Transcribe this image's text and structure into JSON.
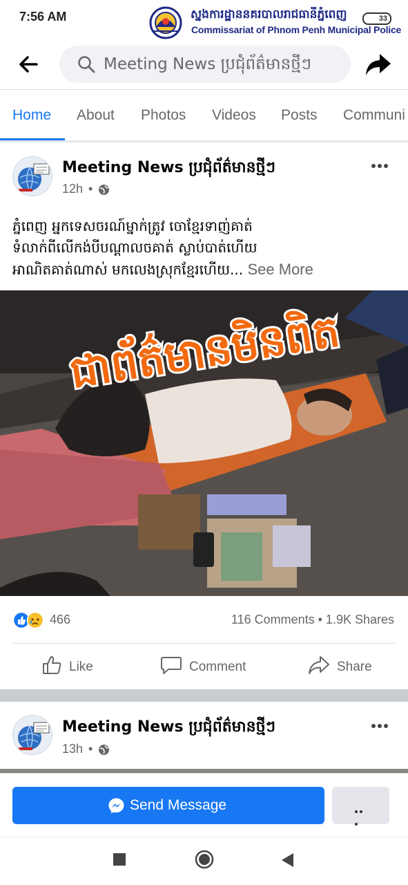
{
  "status_bar": {
    "time": "7:56 AM",
    "battery": "33"
  },
  "watermark": {
    "khmer_text": "ស្នងការដ្ឋាននគរបាលរាជធានីភ្នំពេញ",
    "english_text": "Commissariat of Phnom Penh Municipal Police"
  },
  "header": {
    "search_text": "Meeting News ប្រជុំព័ត៌មានថ្មីៗ"
  },
  "tabs": [
    {
      "label": "Home",
      "active": true
    },
    {
      "label": "About",
      "active": false
    },
    {
      "label": "Photos",
      "active": false
    },
    {
      "label": "Videos",
      "active": false
    },
    {
      "label": "Posts",
      "active": false
    },
    {
      "label": "Communi",
      "active": false
    }
  ],
  "post1": {
    "page_name": "Meeting News ប្រជុំព័ត៌មានថ្មីៗ",
    "time": "12h",
    "text_lines": [
      "ភ្នំពេញ អ្នកទេសចរណ៍ម្នាក់ត្រូវ ចោខ្មែរទាញ់គាត់",
      "ទំលាក់ពីលើកង់បីបណ្ដាលចគាត់ ស្លាប់បាត់ហើយ",
      "អាណិតគាត់ណាស់ មកលេងស្រុកខ្មែរហើយ..."
    ],
    "see_more": "See More",
    "image_overlay_text": "ជាព័ត៌មានមិនពិត",
    "reaction_count": "466",
    "comments_shares": "116 Comments • 1.9K Shares",
    "actions": {
      "like": "Like",
      "comment": "Comment",
      "share": "Share"
    }
  },
  "post2": {
    "page_name": "Meeting News ប្រជុំព័ត៌មានថ្មីៗ",
    "time": "13h"
  },
  "send_bar": {
    "button_label": "Send Message",
    "more_label": "..."
  },
  "colors": {
    "accent": "#1877f2",
    "watermark_blue": "#1f2a86",
    "overlay_orange": "#f26a10"
  }
}
